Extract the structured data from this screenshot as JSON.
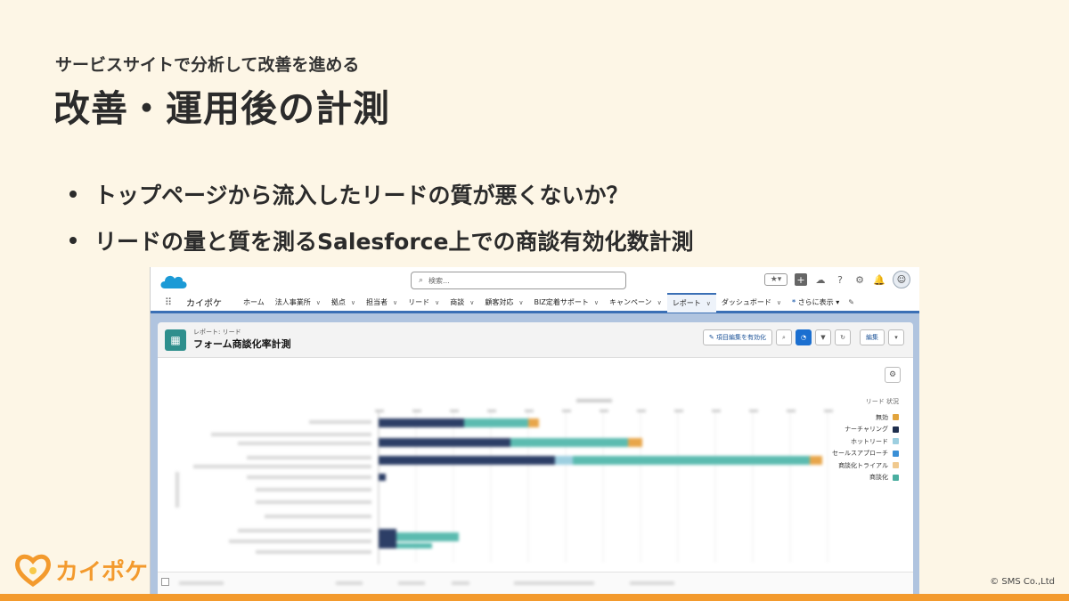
{
  "slide": {
    "subtitle": "サービスサイトで分析して改善を進める",
    "title": "改善・運用後の計測",
    "bullets": [
      "トップページから流入したリードの質が悪くないか？",
      "リードの量と質を測るSalesforce上での商談有効化数計測"
    ],
    "logo_text": "カイポケ",
    "copyright": "© SMS Co.,Ltd"
  },
  "salesforce": {
    "search_placeholder": "検索...",
    "app_name": "カイポケ",
    "nav": [
      {
        "label": "ホーム",
        "dropdown": false
      },
      {
        "label": "法人事業所",
        "dropdown": true
      },
      {
        "label": "拠点",
        "dropdown": true
      },
      {
        "label": "担当者",
        "dropdown": true
      },
      {
        "label": "リード",
        "dropdown": true
      },
      {
        "label": "商談",
        "dropdown": true
      },
      {
        "label": "顧客対応",
        "dropdown": true
      },
      {
        "label": "BIZ定着サポート",
        "dropdown": true
      },
      {
        "label": "キャンペーン",
        "dropdown": true
      },
      {
        "label": "レポート",
        "dropdown": true,
        "active": true
      },
      {
        "label": "ダッシュボード",
        "dropdown": true
      }
    ],
    "nav_more": "さらに表示",
    "report": {
      "breadcrumb": "レポート: リード",
      "title": "フォーム商談化率計測",
      "enable_field_edit_button": "項目編集を有効化",
      "edit_button": "編集"
    },
    "legend": {
      "title": "リード 状況",
      "items": [
        {
          "label": "無効",
          "color": "#e2a43c"
        },
        {
          "label": "ナーチャリング",
          "color": "#1f2f4d"
        },
        {
          "label": "ホットリード",
          "color": "#9dcfe0"
        },
        {
          "label": "セールスアプローチ",
          "color": "#3a8fd6"
        },
        {
          "label": "商談化トライアル",
          "color": "#f0c98e"
        },
        {
          "label": "商談化",
          "color": "#4aaea0"
        }
      ]
    }
  },
  "colors": {
    "background": "#fdf6e6",
    "accent": "#f39a2d",
    "sf_blue": "#3a6fb5"
  }
}
